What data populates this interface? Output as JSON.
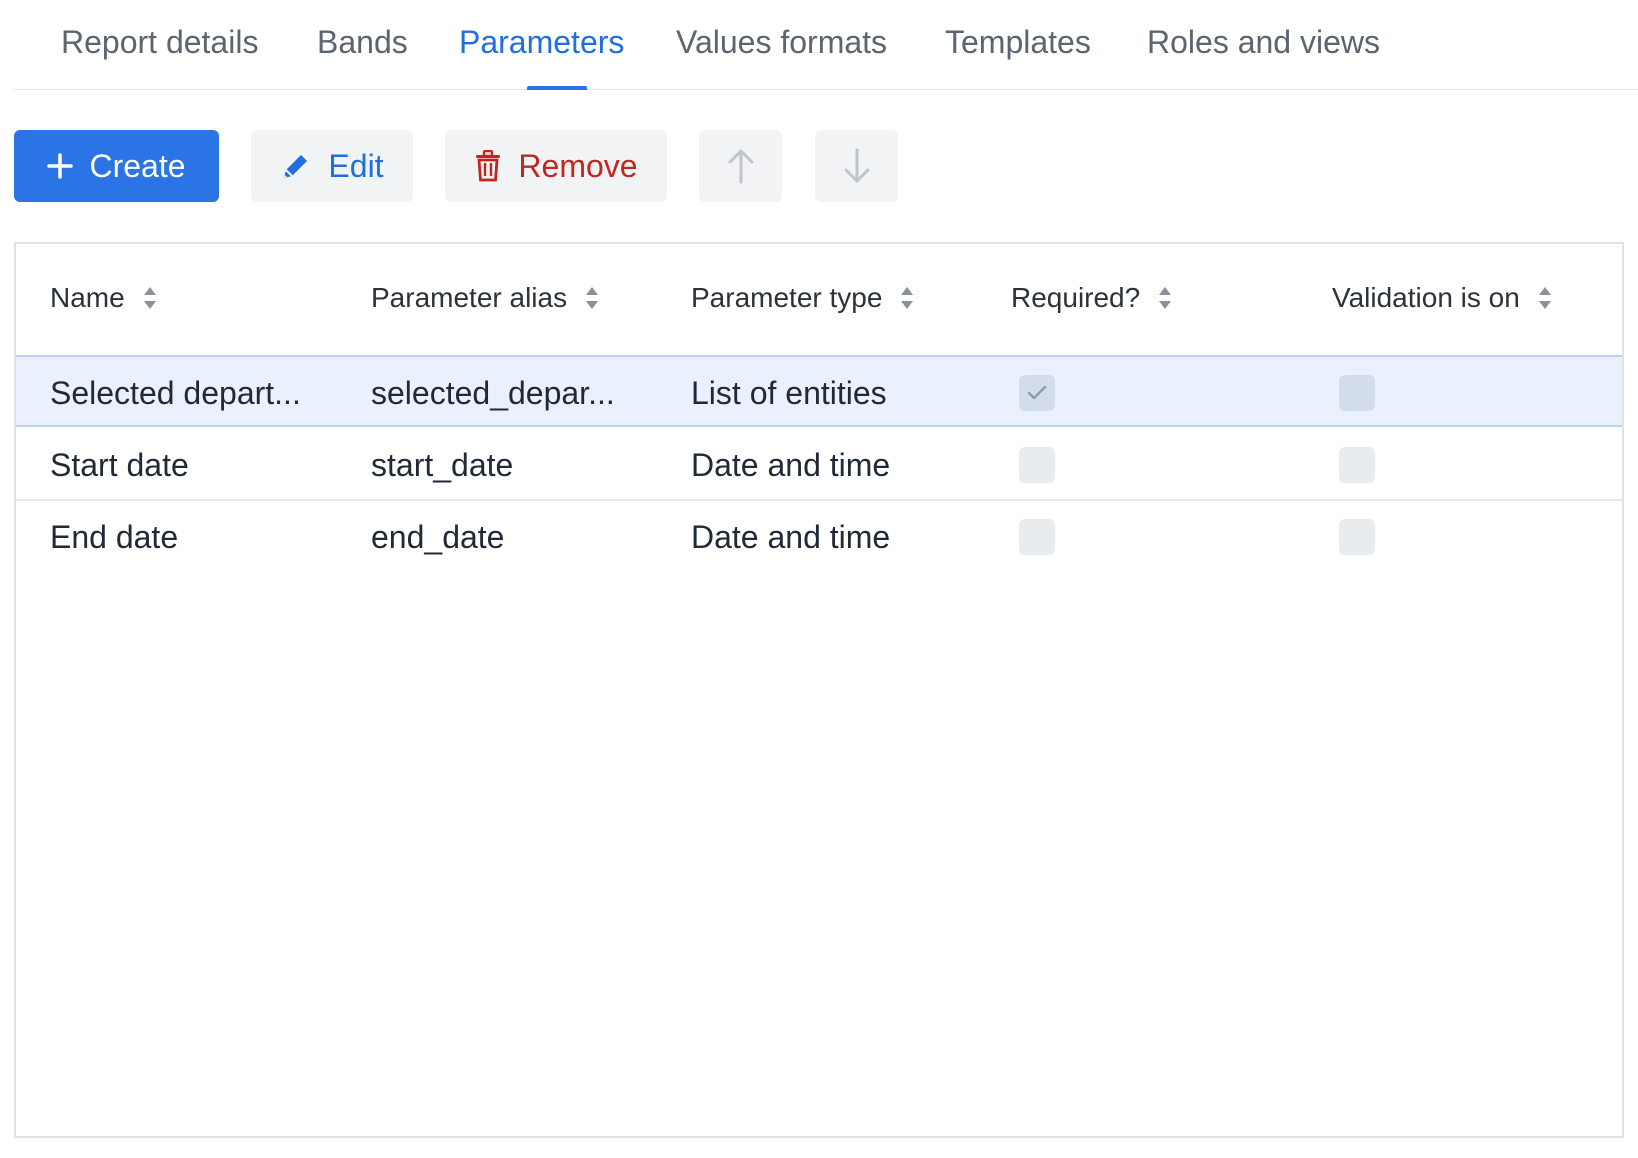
{
  "tabs": [
    {
      "label": "Report details"
    },
    {
      "label": "Bands"
    },
    {
      "label": "Parameters"
    },
    {
      "label": "Values formats"
    },
    {
      "label": "Templates"
    },
    {
      "label": "Roles and views"
    }
  ],
  "active_tab": "Parameters",
  "toolbar": {
    "create_label": "Create",
    "edit_label": "Edit",
    "remove_label": "Remove"
  },
  "table": {
    "columns": [
      "Name",
      "Parameter alias",
      "Parameter type",
      "Required?",
      "Validation is on"
    ],
    "rows": [
      {
        "name": "Selected depart...",
        "alias": "selected_depar...",
        "type": "List of entities",
        "required": true,
        "validation": false,
        "selected": true
      },
      {
        "name": "Start date",
        "alias": "start_date",
        "type": "Date and time",
        "required": false,
        "validation": false,
        "selected": false
      },
      {
        "name": "End date",
        "alias": "end_date",
        "type": "Date and time",
        "required": false,
        "validation": false,
        "selected": false
      }
    ]
  },
  "colors": {
    "accent": "#2a74e6",
    "danger": "#c0271f",
    "selected_row": "#e8f1fd"
  }
}
